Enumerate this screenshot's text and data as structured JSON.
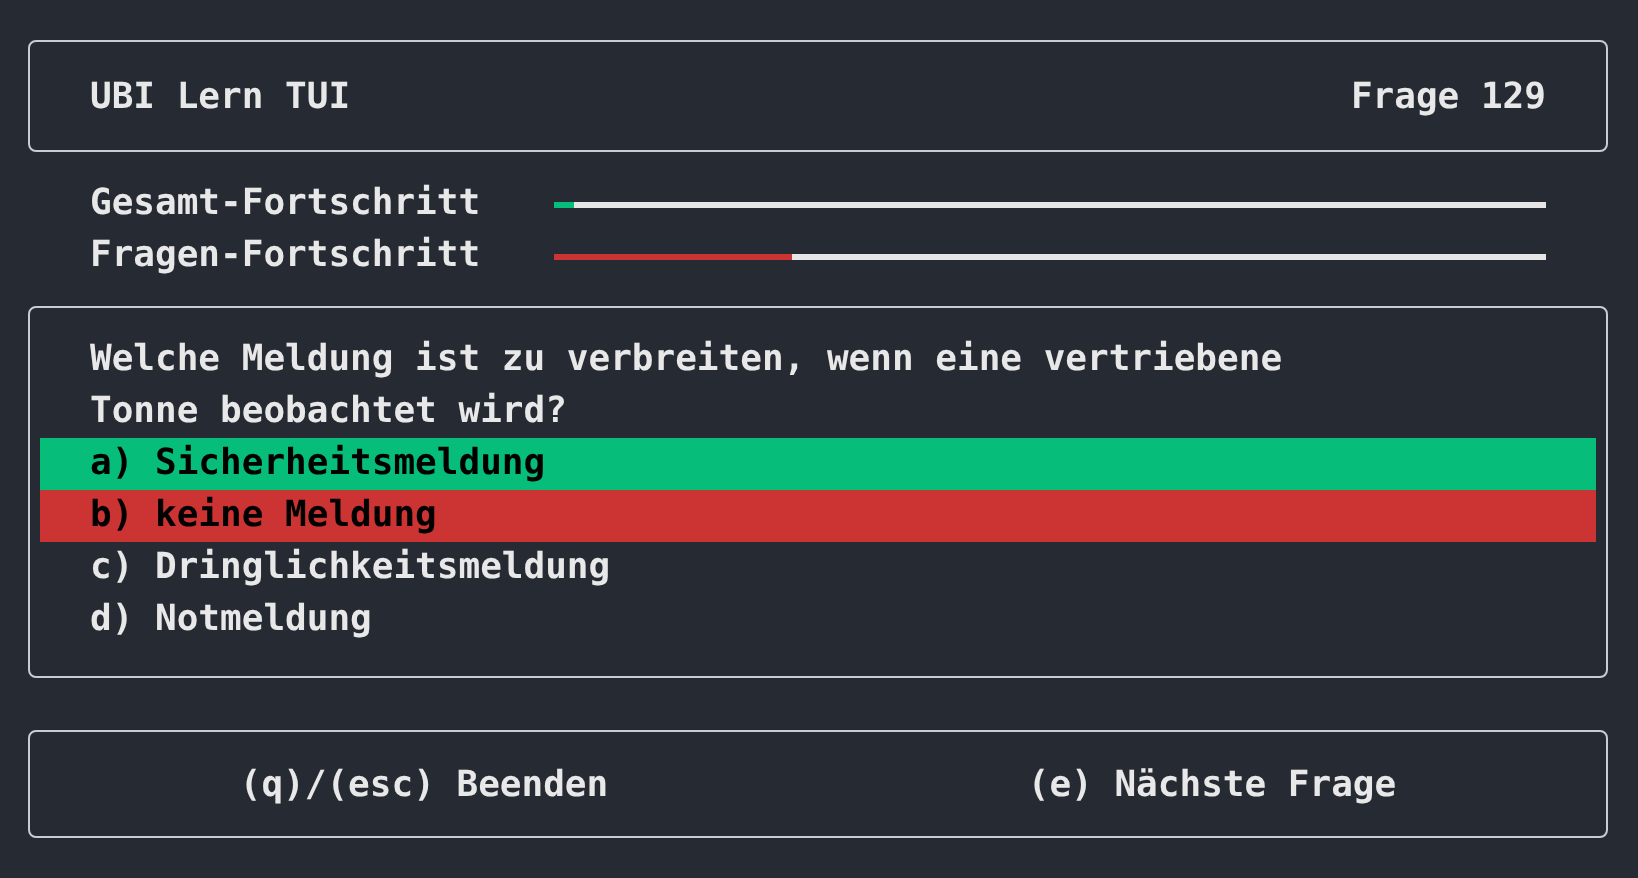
{
  "header": {
    "title": "UBI Lern TUI",
    "counter": "Frage 129"
  },
  "progress": [
    {
      "label": "Gesamt-Fortschritt",
      "level": 0.02,
      "color": "#07bd7a"
    },
    {
      "label": "Fragen-Fortschritt",
      "level": 0.24,
      "color": "#cc3333"
    }
  ],
  "question": {
    "text": "Welche Meldung ist zu verbreiten, wenn eine vertriebene Tonne beobachtet wird?",
    "answers": [
      {
        "label": "a) Sicherheitsmeldung",
        "color": "#07bd7a"
      },
      {
        "label": "b) keine Meldung",
        "color": "#cc3333"
      },
      {
        "label": "c) Dringlichkeitsmeldung"
      },
      {
        "label": "d) Notmeldung"
      }
    ]
  },
  "footer": [
    "(q)/(esc) Beenden",
    "(e) Nächste Frage"
  ]
}
